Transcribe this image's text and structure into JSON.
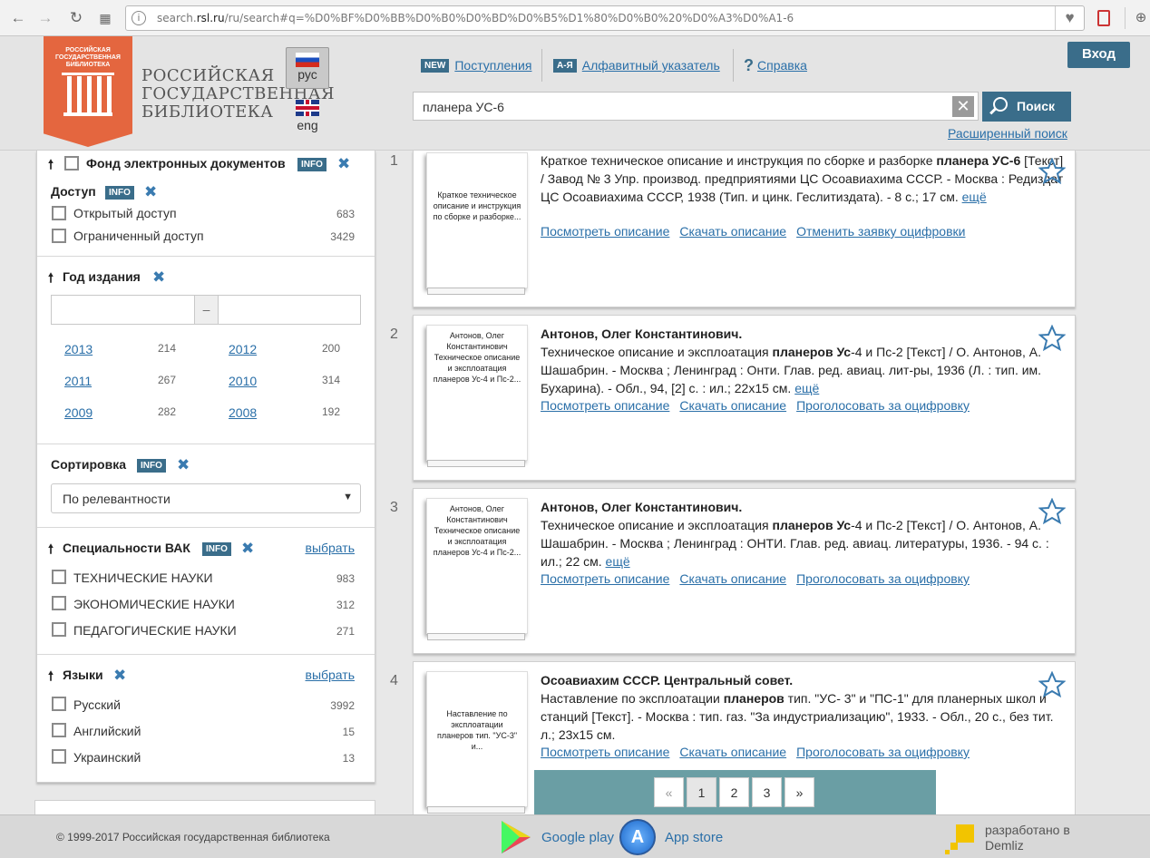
{
  "browser": {
    "url_prefix": "search.",
    "url_domain": "rsl.ru",
    "url_rest": "/ru/search#q=%D0%BF%D0%BB%D0%B0%D0%BD%D0%B5%D1%80%D0%B0%20%D0%A3%D0%A1-6"
  },
  "header": {
    "logo_text": "РОССИЙСКАЯ ГОСУДАРСТВЕННАЯ БИБЛИОТЕКА",
    "library_name_line1": "РОССИЙСКАЯ",
    "library_name_line2": "ГОСУДАРСТВЕННАЯ",
    "library_name_line3": "БИБЛИОТЕКА",
    "lang_ru": "рус",
    "lang_en": "eng",
    "new_badge": "NEW",
    "new_link": "Поступления",
    "az_badge": "А-Я",
    "az_link": "Алфавитный указатель",
    "help_link": "Справка",
    "search_value": "планера УС-6",
    "search_button": "Поиск",
    "advanced_search": "Расширенный поиск",
    "login": "Вход"
  },
  "sidebar": {
    "fund_title": "Фонд электронных документов",
    "info": "INFO",
    "access_title": "Доступ",
    "access_options": [
      {
        "label": "Открытый доступ",
        "count": "683"
      },
      {
        "label": "Ограниченный доступ",
        "count": "3429"
      }
    ],
    "year_title": "Год издания",
    "year_dash": "–",
    "years": [
      {
        "year": "2013",
        "count": "214"
      },
      {
        "year": "2012",
        "count": "200"
      },
      {
        "year": "2011",
        "count": "267"
      },
      {
        "year": "2010",
        "count": "314"
      },
      {
        "year": "2009",
        "count": "282"
      },
      {
        "year": "2008",
        "count": "192"
      }
    ],
    "sort_title": "Сортировка",
    "sort_value": "По релевантности",
    "vak_title": "Специальности ВАК",
    "choose": "выбрать",
    "vak_options": [
      {
        "label": "ТЕХНИЧЕСКИЕ НАУКИ",
        "count": "983"
      },
      {
        "label": "ЭКОНОМИЧЕСКИЕ НАУКИ",
        "count": "312"
      },
      {
        "label": "ПЕДАГОГИЧЕСКИЕ НАУКИ",
        "count": "271"
      }
    ],
    "lang_title": "Языки",
    "lang_options": [
      {
        "label": "Русский",
        "count": "3992"
      },
      {
        "label": "Английский",
        "count": "15"
      },
      {
        "label": "Украинский",
        "count": "13"
      }
    ]
  },
  "results": [
    {
      "num": "1",
      "cover": "Краткое техническое описание и инструкция по сборке и разборке...",
      "text_a": "Краткое техническое описание и инструкция по сборке и разборке ",
      "text_b": "планера УС-6",
      "text_c": " [Текст] / Завод № 3 Упр. производ. предприятиями ЦС Осоавиахима СССР. - Москва : Редиздат ЦС Осоавиахима СССР, 1938 (Тип. и цинк. Геслитиздата). - 8 с.; 17 см.",
      "more": "ещё",
      "link1": "Посмотреть описание",
      "link2": "Скачать описание",
      "link3": "Отменить заявку оцифровки"
    },
    {
      "num": "2",
      "cover": "Антонов, Олег Константинович  Техническое описание и эксплоатация планеров Ус-4 и Пс-2...",
      "author": "Антонов, Олег Константинович.",
      "text_a": "Техническое описание и эксплоатация ",
      "text_b": "планеров Ус",
      "text_c": "-4 и Пс-2 [Текст] / О. Антонов, А. Шашабрин. - Москва ; Ленинград : Онти. Глав. ред. авиац. лит-ры, 1936 (Л. : тип. им. Бухарина). - Обл., 94, [2] с. : ил.; 22x15 см.",
      "more": "ещё",
      "link1": "Посмотреть описание",
      "link2": "Скачать описание",
      "link3": "Проголосовать за оцифровку"
    },
    {
      "num": "3",
      "cover": "Антонов, Олег Константинович  Техническое описание и эксплоатация планеров Ус-4 и Пс-2...",
      "author": "Антонов, Олег Константинович.",
      "text_a": "Техническое описание и эксплоатация ",
      "text_b": "планеров Ус",
      "text_c": "-4 и Пс-2 [Текст] / О. Антонов, А. Шашабрин. - Москва ; Ленинград : ОНТИ. Глав. ред. авиац. литературы, 1936. - 94 с. : ил.; 22 см.",
      "more": "ещё",
      "link1": "Посмотреть описание",
      "link2": "Скачать описание",
      "link3": "Проголосовать за оцифровку"
    },
    {
      "num": "4",
      "cover": "Наставление по эксплоатации планеров тип. \"УС-3\" и...",
      "author": "Осоавиахим СССР. Центральный совет.",
      "text_a": "Наставление по эксплоатации ",
      "text_b": "планеров",
      "text_c": " тип. \"УС- 3\" и \"ПС-1\" для планерных школ и станций [Текст]. - Москва : тип. газ. \"За индустриализацию\", 1933. - Обл., 20 с., без тит. л.; 23x15 см.",
      "link1": "Посмотреть описание",
      "link2": "Скачать описание",
      "link3": "Проголосовать за оцифровку"
    }
  ],
  "pagination": {
    "prev": "«",
    "pages": [
      "1",
      "2",
      "3"
    ],
    "next": "»"
  },
  "footer": {
    "copyright": "© 1999-2017 Российская государственная библиотека",
    "google_play": "Google play",
    "app_store": "App store",
    "dev_line1": "разработано в",
    "dev_line2": "Demliz"
  },
  "colors": {
    "accent": "#3a6d8a",
    "brand": "#e4663f",
    "link": "#2a6fa8",
    "pager": "#6a9ea4"
  }
}
